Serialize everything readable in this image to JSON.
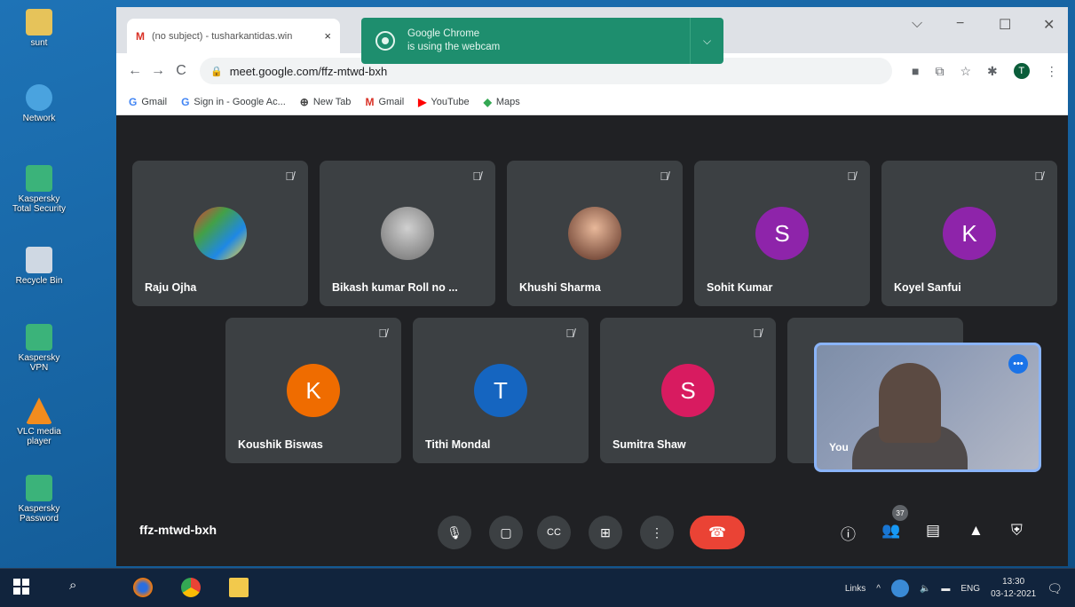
{
  "desktop": {
    "icons": [
      {
        "label": "sunt",
        "color": "#e6c35a"
      },
      {
        "label": "Network",
        "color": "#4aa3df"
      },
      {
        "label": "Kaspersky Total Security",
        "color": "#3bb37a"
      },
      {
        "label": "Recycle Bin",
        "color": "#cfd8e3"
      },
      {
        "label": "Kaspersky VPN",
        "color": "#3bb37a"
      },
      {
        "label": "VLC media player",
        "color": "#f28c1e"
      },
      {
        "label": "Kaspersky Password",
        "color": "#3bb37a"
      }
    ]
  },
  "browser": {
    "tab": {
      "icon": "M",
      "title": "(no subject) - tusharkantidas.win",
      "close": "×"
    },
    "window_controls": {
      "dropdown": "⌵",
      "minimize": "−",
      "maximize": "☐",
      "close": "✕"
    },
    "notice": {
      "line1": "Google Chrome",
      "line2": "is using the webcam",
      "chevron": "⌵"
    },
    "nav": {
      "back": "←",
      "forward": "→",
      "reload": "C"
    },
    "url": "meet.google.com/ffz-mtwd-bxh",
    "profile_initial": "T",
    "bookmarks": [
      {
        "icon": "G",
        "label": "Gmail",
        "color": "#4285f4"
      },
      {
        "icon": "G",
        "label": "Sign in - Google Ac...",
        "color": "#4285f4"
      },
      {
        "icon": "⊕",
        "label": "New Tab",
        "color": "#444"
      },
      {
        "icon": "M",
        "label": "Gmail",
        "color": "#d93025"
      },
      {
        "icon": "▶",
        "label": "YouTube",
        "color": "#ff0000"
      },
      {
        "icon": "◆",
        "label": "Maps",
        "color": "#34a853"
      }
    ]
  },
  "meet": {
    "participants": [
      {
        "name": "Raju Ojha",
        "initial": "",
        "color": "#6a8cc7",
        "photo": true
      },
      {
        "name": "Bikash kumar Roll no ...",
        "initial": "",
        "color": "#9a9a9a",
        "photo": true
      },
      {
        "name": "Khushi Sharma",
        "initial": "",
        "color": "#a0604a",
        "photo": true
      },
      {
        "name": "Sohit Kumar",
        "initial": "S",
        "color": "#8e24aa",
        "photo": false
      },
      {
        "name": "Koyel Sanfui",
        "initial": "K",
        "color": "#8e24aa",
        "photo": false
      },
      {
        "name": "Koushik Biswas",
        "initial": "K",
        "color": "#ef6c00",
        "photo": false
      },
      {
        "name": "Tithi Mondal",
        "initial": "T",
        "color": "#1565c0",
        "photo": false
      },
      {
        "name": "Sumitra Shaw",
        "initial": "S",
        "color": "#d81b60",
        "photo": false
      }
    ],
    "self_label": "You",
    "meeting_code": "ffz-mtwd-bxh",
    "participant_count": "37",
    "controls": {
      "mic": "🎙",
      "camera": "▢",
      "captions": "CC",
      "present": "⊞",
      "more": "⋮",
      "end": "☎"
    }
  },
  "taskbar": {
    "links": "Links",
    "lang": "ENG",
    "time": "13:30",
    "date": "03-12-2021"
  }
}
